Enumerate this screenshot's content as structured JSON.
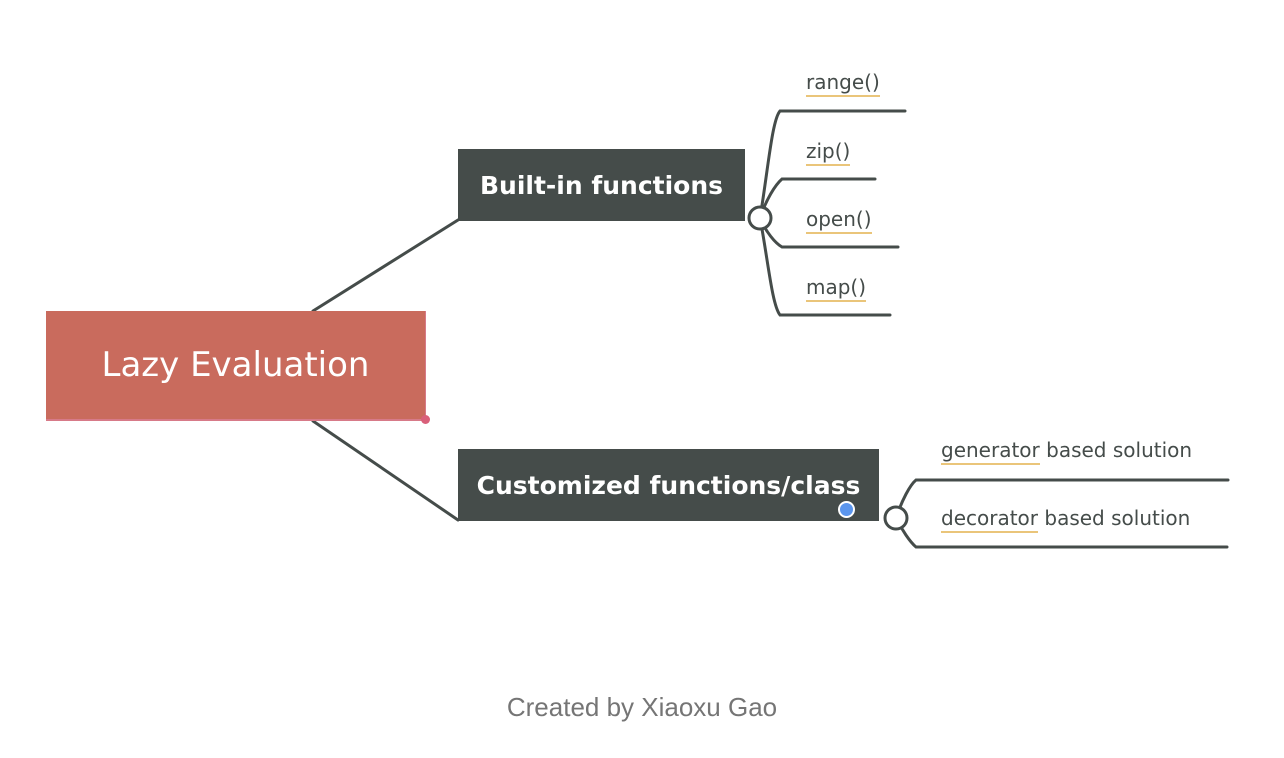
{
  "diagram": {
    "type": "mind-map",
    "root": {
      "label": "Lazy Evaluation",
      "color": "#c96b5d"
    },
    "branches": [
      {
        "label": "Built-in functions",
        "color": "#454c4a",
        "children": [
          {
            "keyword": "range()",
            "rest": ""
          },
          {
            "keyword": "zip()",
            "rest": ""
          },
          {
            "keyword": "open()",
            "rest": ""
          },
          {
            "keyword": "map()",
            "rest": ""
          }
        ]
      },
      {
        "label": "Customized functions/class",
        "color": "#454c4a",
        "children": [
          {
            "keyword": "generator",
            "rest": " based solution"
          },
          {
            "keyword": "decorator",
            "rest": " based solution"
          }
        ]
      }
    ],
    "underline_color": "#eac57a",
    "line_color": "#454c4a"
  },
  "footer": {
    "credit": "Created by Xiaoxu Gao"
  }
}
